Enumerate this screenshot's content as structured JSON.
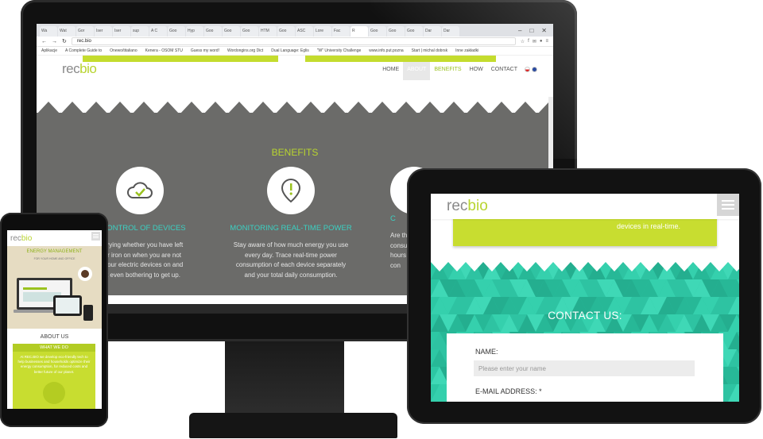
{
  "desktop": {
    "tabs": [
      "Wa",
      "Wat",
      "Gor",
      "Iser",
      "Iser",
      "sup",
      "A C",
      "Goo",
      "Hyp",
      "Goo",
      "Goo",
      "Goo",
      "HTM",
      "Goo",
      "ASC",
      "Lore",
      "Fac",
      "R",
      "Goo",
      "Goo",
      "Goo",
      "Dar",
      "Dar"
    ],
    "active_tab_index": 17,
    "url": "rec.bio",
    "bookmarks": [
      "Aplikacje",
      "A Complete Guide to",
      "Onewo/titaliano",
      "Kenera - OSOM STU",
      "Guess my word!",
      "Wordongins.org Dict",
      "Dual Language: Eglis",
      "\"W\" University Challenge",
      "www.info.put.pozna",
      "Start | michal dobrsk",
      "Inne zakładki"
    ],
    "site": {
      "logo_a": "rec",
      "logo_b": "bio",
      "nav": [
        "HOME",
        "ABOUT",
        "BENEFITS",
        "HOW",
        "CONTACT"
      ],
      "section_title": "BENEFITS",
      "features": [
        {
          "title": "E CONTROL OF DEVICES",
          "text": "worrying whether you have left\nn or iron on when you are not\nrn your electric devices on and\nout even bothering to get up."
        },
        {
          "title": "MONITORING REAL-TIME POWER",
          "text": "Stay aware of how much energy you use\nevery day. Trace real-time power\nconsumption of each device separately\nand your total daily consumption."
        },
        {
          "title": "C",
          "text": "Are th\nconsum\nhours of\ncon"
        }
      ]
    }
  },
  "tablet": {
    "logo_a": "rec",
    "logo_b": "bio",
    "green_text": "devices in real-time.",
    "contact_title": "CONTACT US:",
    "name_label": "NAME:",
    "name_placeholder": "Please enter your name",
    "email_label": "E-MAIL ADDRESS: *"
  },
  "phone": {
    "logo_a": "rec",
    "logo_b": "bio",
    "hero_title": "ENERGY MANAGEMENT",
    "hero_sub": "FOR YOUR HOME AND OFFICE",
    "about_title": "ABOUT US",
    "card_title": "WHAT WE DO",
    "card_text": "At REC.BIO we develop eco-friendly tech to help businesses and households optimize their energy consumption, for reduced costs and better future of our planet."
  }
}
